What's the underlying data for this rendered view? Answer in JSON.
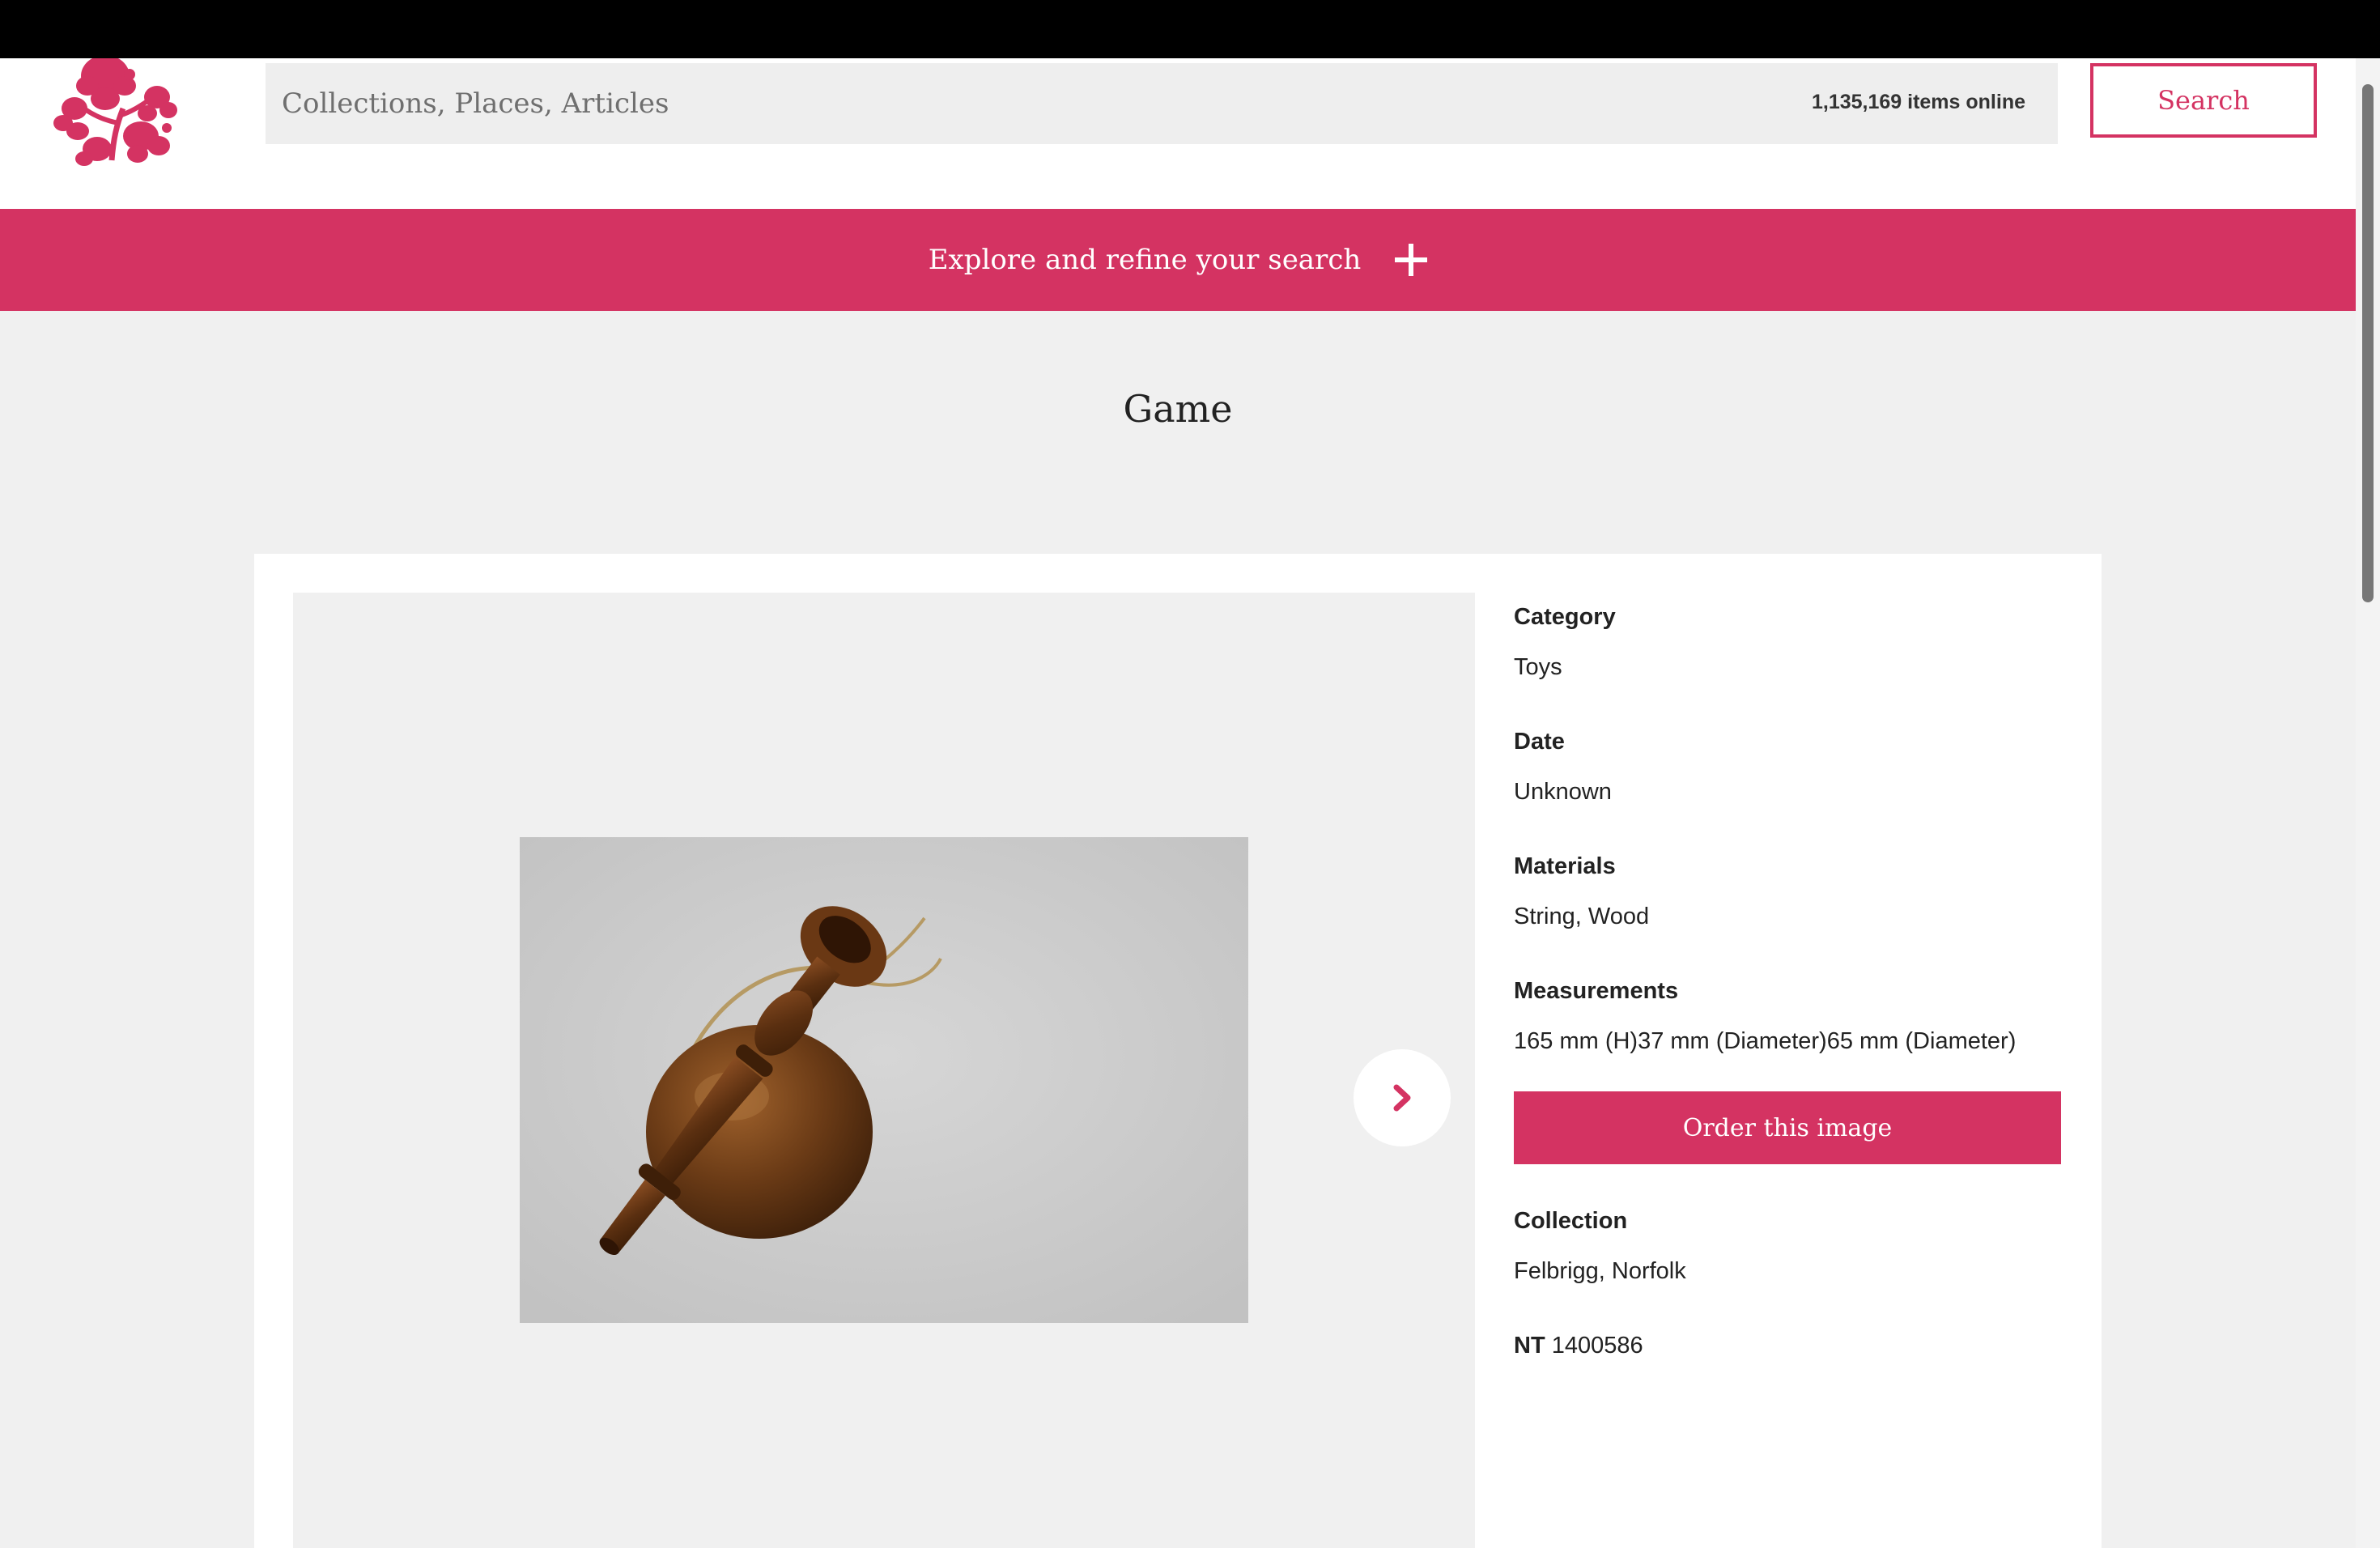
{
  "header": {
    "search_placeholder": "Collections, Places, Articles",
    "items_count": "1,135,169 items online",
    "search_label": "Search"
  },
  "refine": {
    "label": "Explore and refine your search"
  },
  "page": {
    "title": "Game"
  },
  "details": {
    "category_label": "Category",
    "category_value": "Toys",
    "date_label": "Date",
    "date_value": "Unknown",
    "materials_label": "Materials",
    "materials_value": "String, Wood",
    "measurements_label": "Measurements",
    "measurements_value": "165 mm (H)37 mm (Diameter)65 mm (Diameter)",
    "order_label": "Order this image",
    "collection_label": "Collection",
    "collection_value": "Felbrigg, Norfolk",
    "nt_label": "NT",
    "nt_value": "1400586"
  },
  "colors": {
    "brand": "#d43362",
    "background": "#f0f0f0",
    "search_box": "#eeeeee"
  },
  "icons": {
    "logo": "oak-leaf-logo",
    "refine": "plus-icon",
    "next": "chevron-right-icon"
  }
}
